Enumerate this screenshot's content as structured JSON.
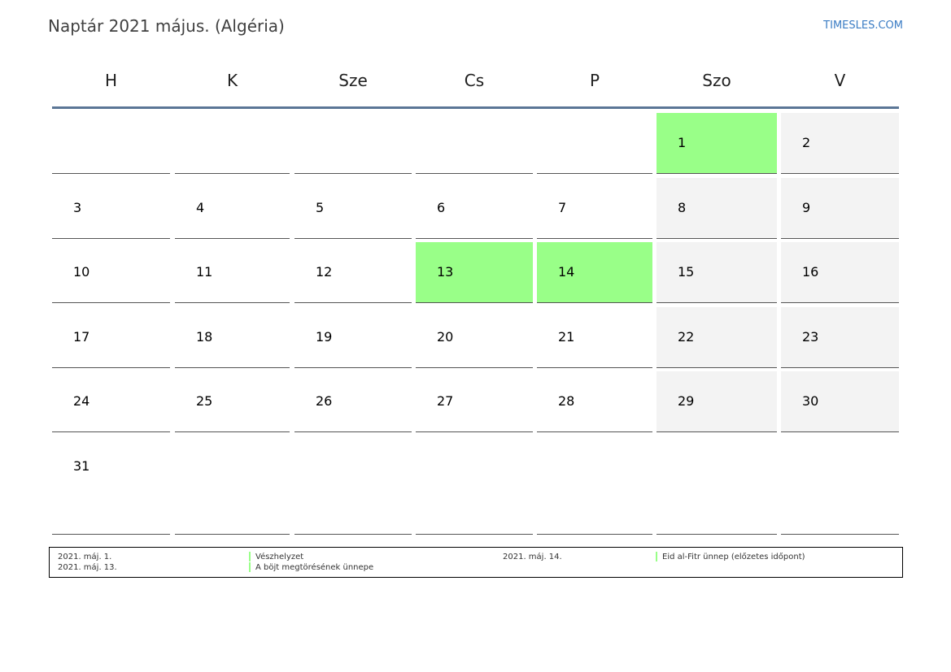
{
  "header": {
    "title": "Naptár 2021 május. (Algéria)",
    "brand": "TIMESLES.COM"
  },
  "weekdays": [
    "H",
    "K",
    "Sze",
    "Cs",
    "P",
    "Szo",
    "V"
  ],
  "colors": {
    "holiday": "#99ff88",
    "weekend": "#f3f3f3",
    "header_line": "#5b7696",
    "brand": "#3a7cc4"
  },
  "weeks": [
    [
      "",
      "",
      "",
      "",
      "",
      "1",
      "2"
    ],
    [
      "3",
      "4",
      "5",
      "6",
      "7",
      "8",
      "9"
    ],
    [
      "10",
      "11",
      "12",
      "13",
      "14",
      "15",
      "16"
    ],
    [
      "17",
      "18",
      "19",
      "20",
      "21",
      "22",
      "23"
    ],
    [
      "24",
      "25",
      "26",
      "27",
      "28",
      "29",
      "30"
    ],
    [
      "31",
      "",
      "",
      "",
      "",
      "",
      ""
    ]
  ],
  "highlighted_days": [
    "1",
    "13",
    "14"
  ],
  "legend": [
    {
      "date": "2021. máj. 1.",
      "name": "Vészhelyzet"
    },
    {
      "date": "2021. máj. 13.",
      "name": "A böjt megtörésének ünnepe"
    },
    {
      "date": "2021. máj. 14.",
      "name": "Eid al-Fitr ünnep (előzetes időpont)"
    }
  ]
}
